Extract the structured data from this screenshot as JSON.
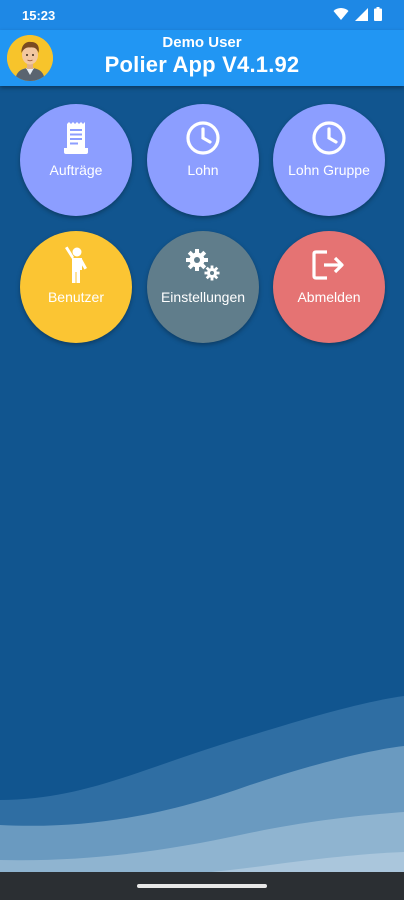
{
  "status_bar": {
    "time": "15:23",
    "icons": [
      "wifi-icon",
      "signal-icon",
      "battery-icon"
    ]
  },
  "header": {
    "user_name": "Demo User",
    "app_title": "Polier App V4.1.92",
    "avatar_icon": "user-avatar-icon"
  },
  "menu": {
    "items": [
      {
        "label": "Aufträge",
        "icon": "document-icon",
        "color": "#8c9eff"
      },
      {
        "label": "Lohn",
        "icon": "clock-icon",
        "color": "#8c9eff"
      },
      {
        "label": "Lohn Gruppe",
        "icon": "clock-icon",
        "color": "#8c9eff"
      },
      {
        "label": "Benutzer",
        "icon": "person-waving-icon",
        "color": "#fbc533"
      },
      {
        "label": "Einstellungen",
        "icon": "gears-icon",
        "color": "#607d8b"
      },
      {
        "label": "Abmelden",
        "icon": "logout-icon",
        "color": "#e57373"
      }
    ]
  },
  "colors": {
    "status_bar": "#1e88e5",
    "header": "#2196f3",
    "background": "#11558f"
  }
}
